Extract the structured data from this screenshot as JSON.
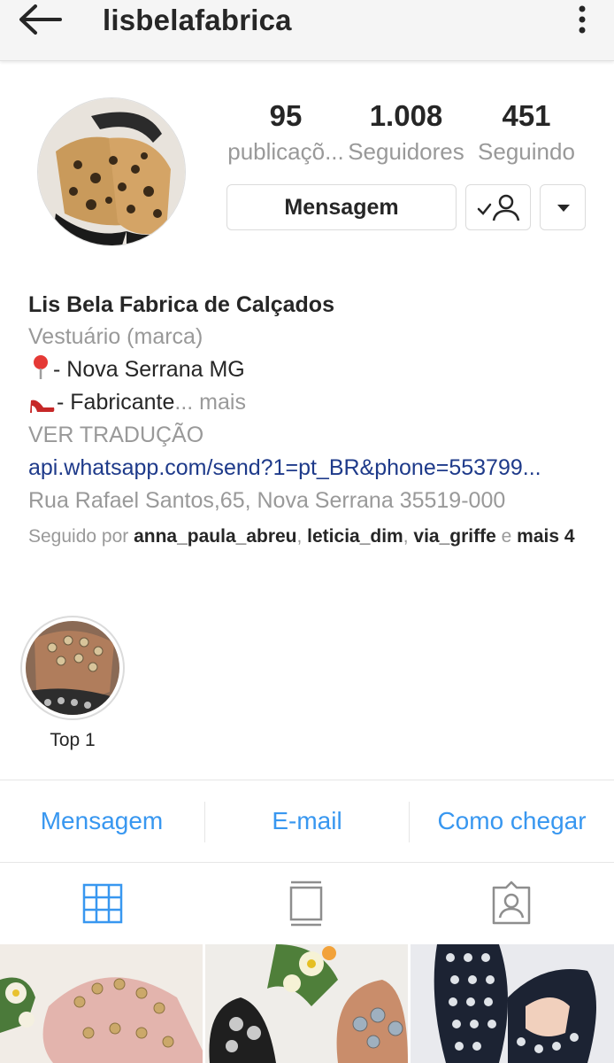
{
  "header": {
    "username": "lisbelafabrica"
  },
  "stats": [
    {
      "value": "95",
      "label": "publicaçõ..."
    },
    {
      "value": "1.008",
      "label": "Seguidores"
    },
    {
      "value": "451",
      "label": "Seguindo"
    }
  ],
  "buttons": {
    "message": "Mensagem"
  },
  "bio": {
    "name": "Lis Bela Fabrica de Calçados",
    "category": "Vestuário (marca)",
    "line1": "- Nova Serrana MG",
    "line2": "- Fabricante",
    "more": "... mais",
    "translate": "VER TRADUÇÃO",
    "link": "api.whatsapp.com/send?1=pt_BR&phone=553799...",
    "address": "Rua Rafael Santos,65, Nova Serrana 35519-000"
  },
  "followed_by": {
    "prefix": "Seguido por ",
    "users": [
      "anna_paula_abreu",
      "leticia_dim",
      "via_griffe"
    ],
    "and": " e ",
    "more": "mais 4"
  },
  "highlight": {
    "label": "Top 1"
  },
  "actions": [
    "Mensagem",
    "E-mail",
    "Como chegar"
  ],
  "icons": {
    "back": "arrow-left-icon",
    "menu": "more-vertical-icon",
    "follow": "user-check-icon",
    "dropdown": "caret-down-icon",
    "pin": "map-pin-emoji",
    "shoe": "high-heel-emoji",
    "grid": "grid-icon",
    "feed": "feed-icon",
    "tagged": "tagged-person-icon"
  },
  "colors": {
    "accent": "#3897f0",
    "link": "#1e3a8a",
    "gray": "#999999"
  }
}
